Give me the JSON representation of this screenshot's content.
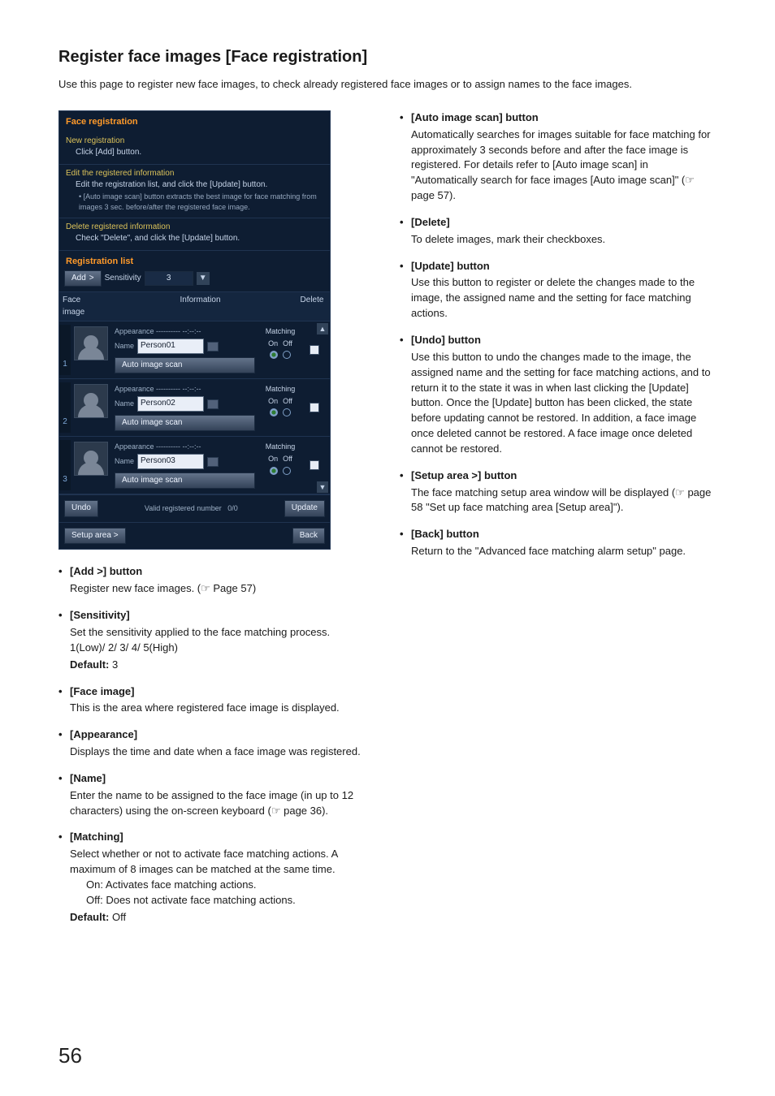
{
  "page": {
    "title": "Register face images [Face registration]",
    "intro": "Use this page to register new face images, to check already registered face images or to assign names to the face images.",
    "number": "56"
  },
  "panel": {
    "title": "Face registration",
    "sec1_head": "New registration",
    "sec1_sub": "Click [Add] button.",
    "sec2_head": "Edit the registered information",
    "sec2_sub": "Edit the registration list, and click the [Update] button.",
    "sec2_note": "• [Auto image scan] button extracts the best image for face matching from images 3 sec. before/after the registered face image.",
    "sec3_head": "Delete registered information",
    "sec3_sub": "Check \"Delete\", and click the [Update] button.",
    "reglist_title": "Registration list",
    "add_label": "Add",
    "sensitivity_label": "Sensitivity",
    "sensitivity_value": "3",
    "col_face": "Face image",
    "col_info": "Information",
    "col_delete": "Delete",
    "appearance_label": "Appearance",
    "appearance_value": "---------- --:--:--",
    "name_label": "Name",
    "auto_image_scan_label": "Auto image scan",
    "matching_label": "Matching",
    "on_label": "On",
    "off_label": "Off",
    "undo_label": "Undo",
    "valid_label": "Valid registered number",
    "valid_value": "0/0",
    "update_label": "Update",
    "setup_area_label": "Setup area  >",
    "back_label": "Back",
    "rows": [
      {
        "idx": "1",
        "name": "Person01"
      },
      {
        "idx": "2",
        "name": "Person02"
      },
      {
        "idx": "3",
        "name": "Person03"
      }
    ]
  },
  "left_items": [
    {
      "title": "[Add >] button",
      "body": "Register new face images. (☞ Page 57)"
    },
    {
      "title": "[Sensitivity]",
      "body": "Set the sensitivity applied to the face matching process.\n1(Low)/ 2/ 3/ 4/ 5(High)",
      "default": "3"
    },
    {
      "title": "[Face image]",
      "body": "This is the area where registered face image is displayed."
    },
    {
      "title": "[Appearance]",
      "body": "Displays the time and date when a face image was registered."
    },
    {
      "title": "[Name]",
      "body": "Enter the name to be assigned to the face image (in up to 12 characters) using the on-screen keyboard (☞ page 36)."
    },
    {
      "title": "[Matching]",
      "body": "Select whether or not to activate face matching actions. A maximum of 8 images can be matched at the same time.",
      "sub": [
        "On: Activates face matching actions.",
        "Off: Does not activate face matching actions."
      ],
      "default": "Off"
    }
  ],
  "right_items": [
    {
      "title": "[Auto image scan] button",
      "body": "Automatically searches for images suitable for face matching for approximately 3 seconds before and after the face image is registered. For details refer to [Auto image scan] in \"Automatically search for face images [Auto image scan]\" (☞ page 57)."
    },
    {
      "title": "[Delete]",
      "body": "To delete images, mark their checkboxes."
    },
    {
      "title": "[Update] button",
      "body": "Use this button to register or delete the changes made to the image, the assigned name and the setting for face matching actions."
    },
    {
      "title": "[Undo] button",
      "body": "Use this button to undo the changes made to the image, the assigned name and the setting for face matching actions, and to return it to the state it was in when last clicking the [Update] button. Once the [Update] button has been clicked, the state before updating cannot be restored. In addition, a face image once deleted cannot be restored. A face image once deleted cannot be restored."
    },
    {
      "title": "[Setup area >] button",
      "body": "The face matching setup area window will be displayed (☞ page 58 \"Set up face matching area [Setup area]\")."
    },
    {
      "title": "[Back] button",
      "body": "Return to the \"Advanced face matching alarm setup\" page."
    }
  ],
  "default_label": "Default:"
}
